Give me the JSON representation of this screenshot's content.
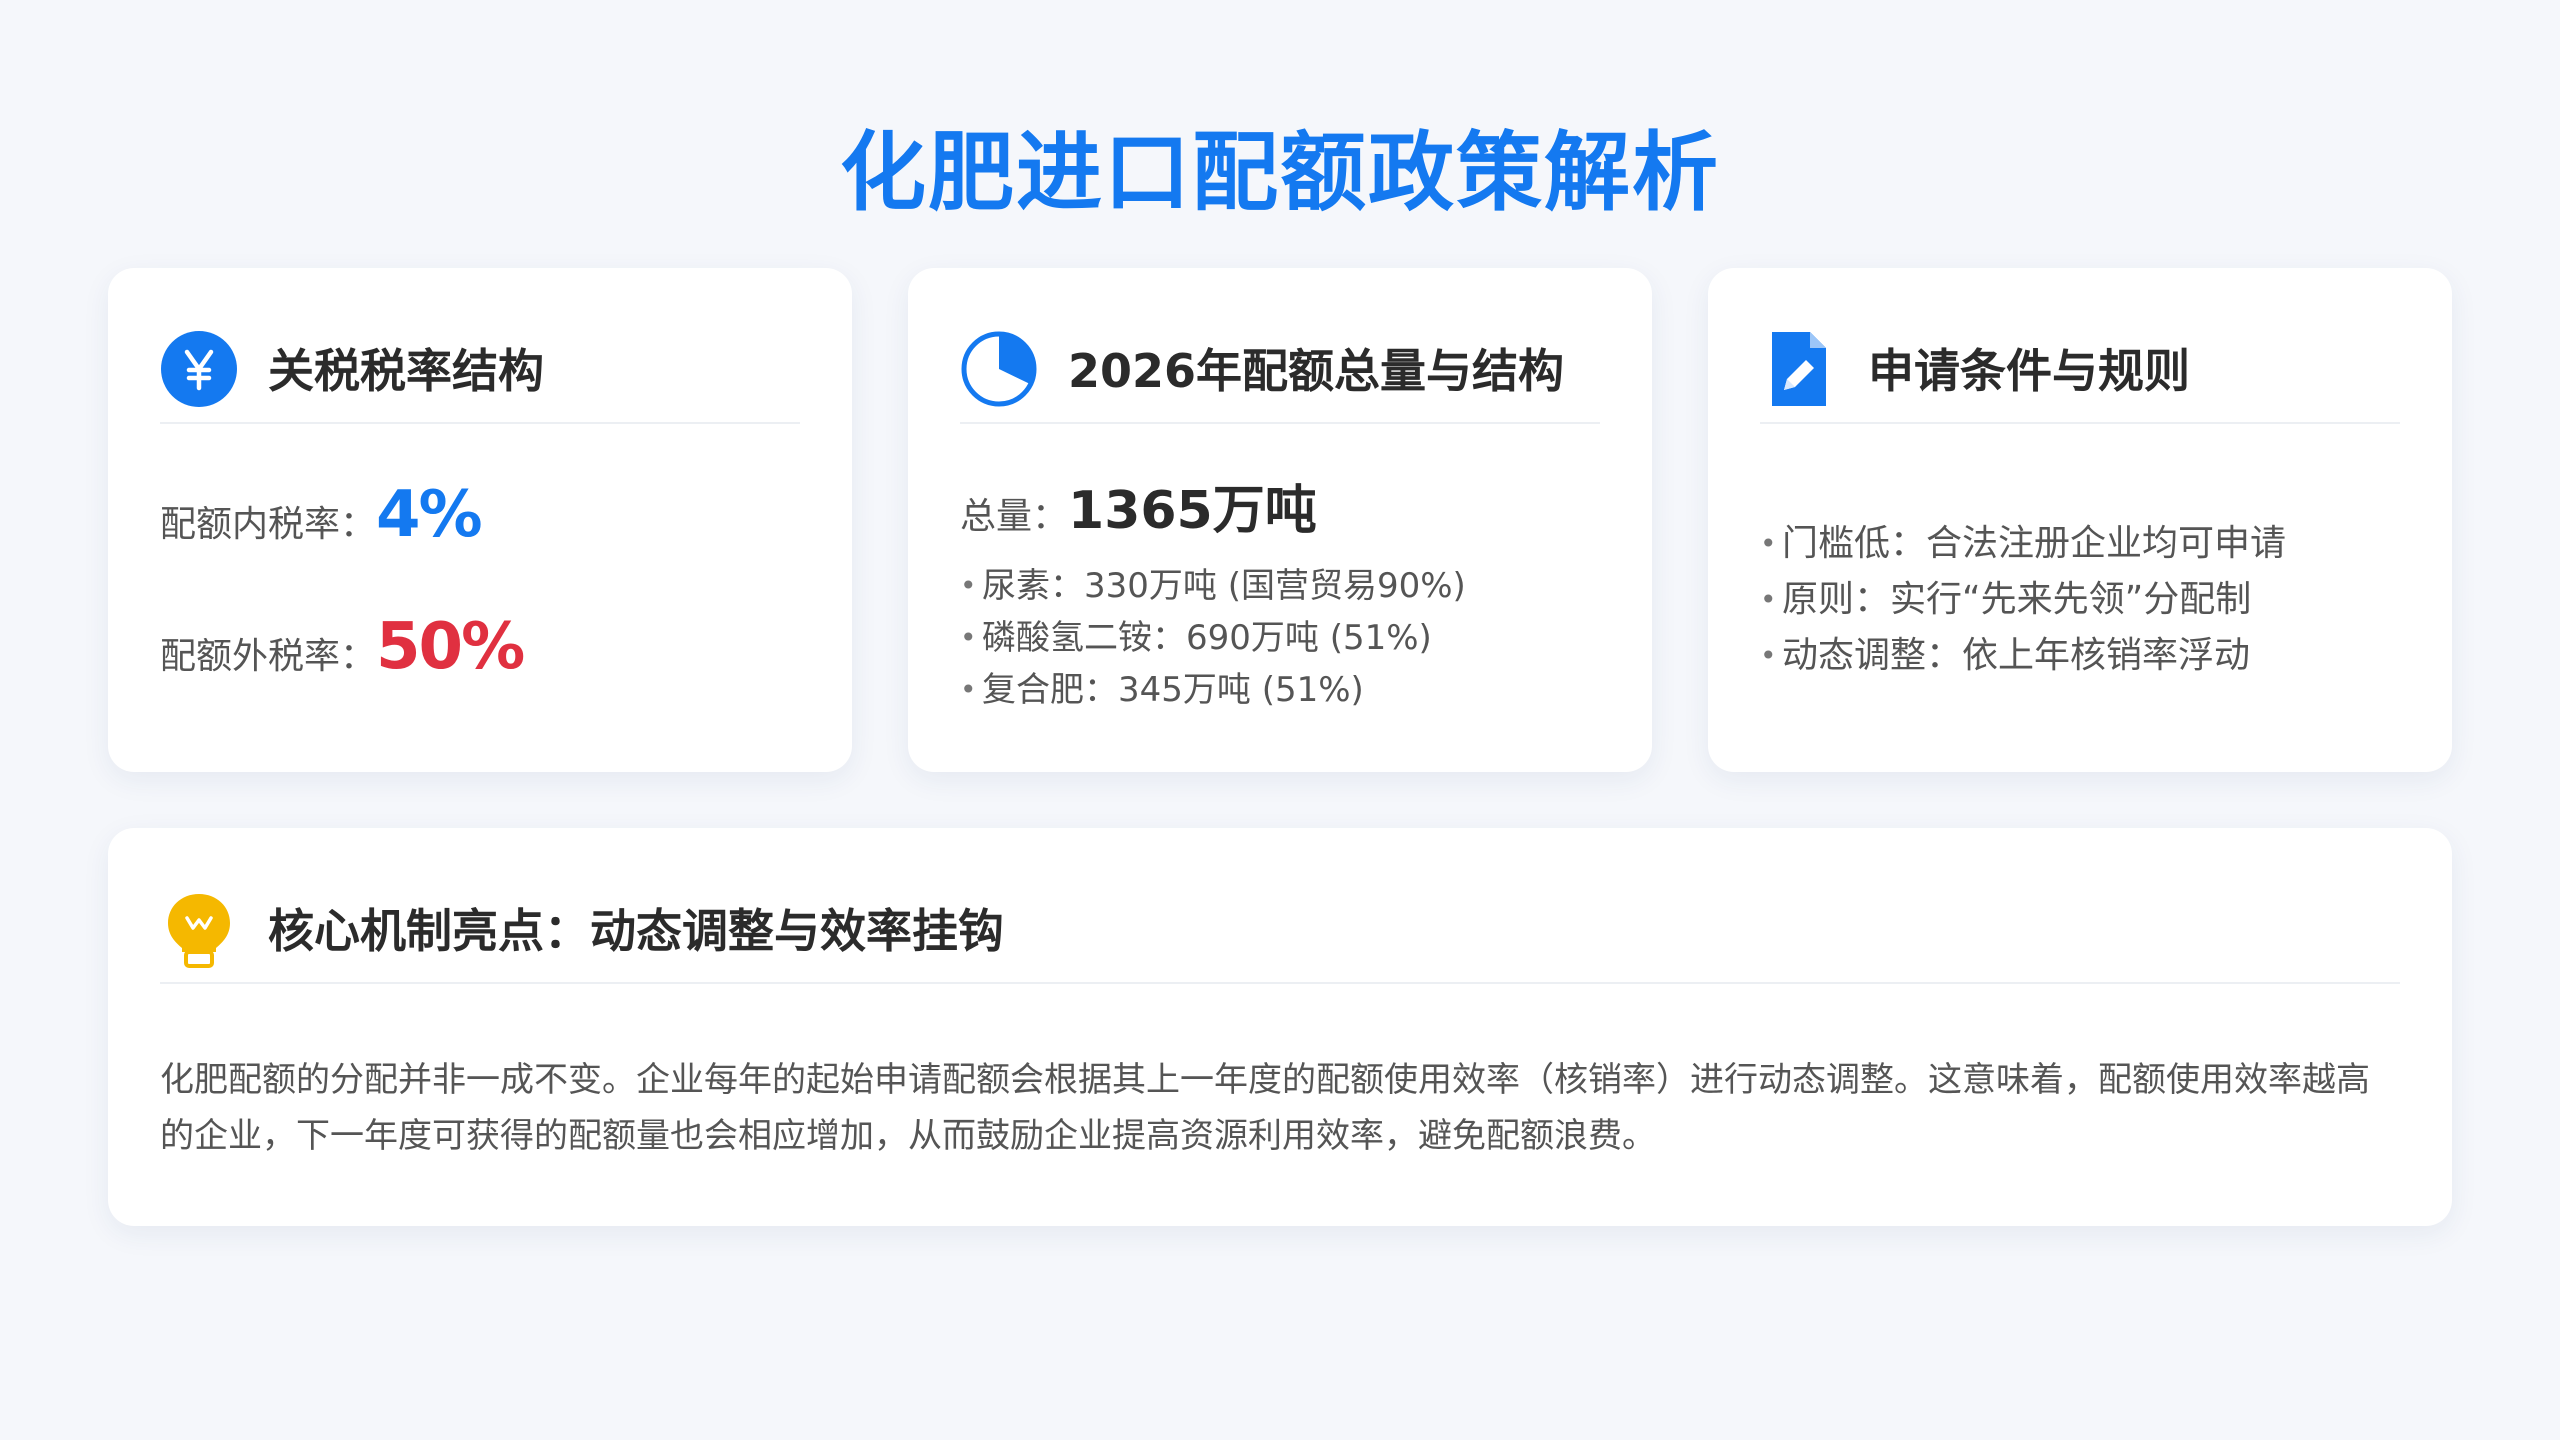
{
  "page": {
    "title": "化肥进口配额政策解析"
  },
  "colors": {
    "accent_blue": "#1479f0",
    "alert_red": "#e03040",
    "bulb_yellow": "#f5b800",
    "background": "#f5f7fb"
  },
  "tariff_card": {
    "icon": "yen-circle-icon",
    "title": "关税税率结构",
    "in_quota_label": "配额内税率：",
    "in_quota_value": "4%",
    "out_quota_label": "配额外税率：",
    "out_quota_value": "50%"
  },
  "quota_card": {
    "icon": "pie-chart-icon",
    "title": "2026年配额总量与结构",
    "total_label": "总量：",
    "total_value": "1365万吨",
    "items": [
      "尿素：330万吨 (国营贸易90%)",
      "磷酸氢二铵：690万吨 (51%)",
      "复合肥：345万吨 (51%)"
    ]
  },
  "rules_card": {
    "icon": "document-edit-icon",
    "title": "申请条件与规则",
    "items": [
      "门槛低：合法注册企业均可申请",
      "原则：实行“先来先领”分配制",
      "动态调整：依上年核销率浮动"
    ]
  },
  "mechanism_card": {
    "icon": "lightbulb-icon",
    "title": "核心机制亮点：动态调整与效率挂钩",
    "body": "化肥配额的分配并非一成不变。企业每年的起始申请配额会根据其上一年度的配额使用效率（核销率）进行动态调整。这意味着，配额使用效率越高的企业，下一年度可获得的配额量也会相应增加，从而鼓励企业提高资源利用效率，避免配额浪费。"
  }
}
